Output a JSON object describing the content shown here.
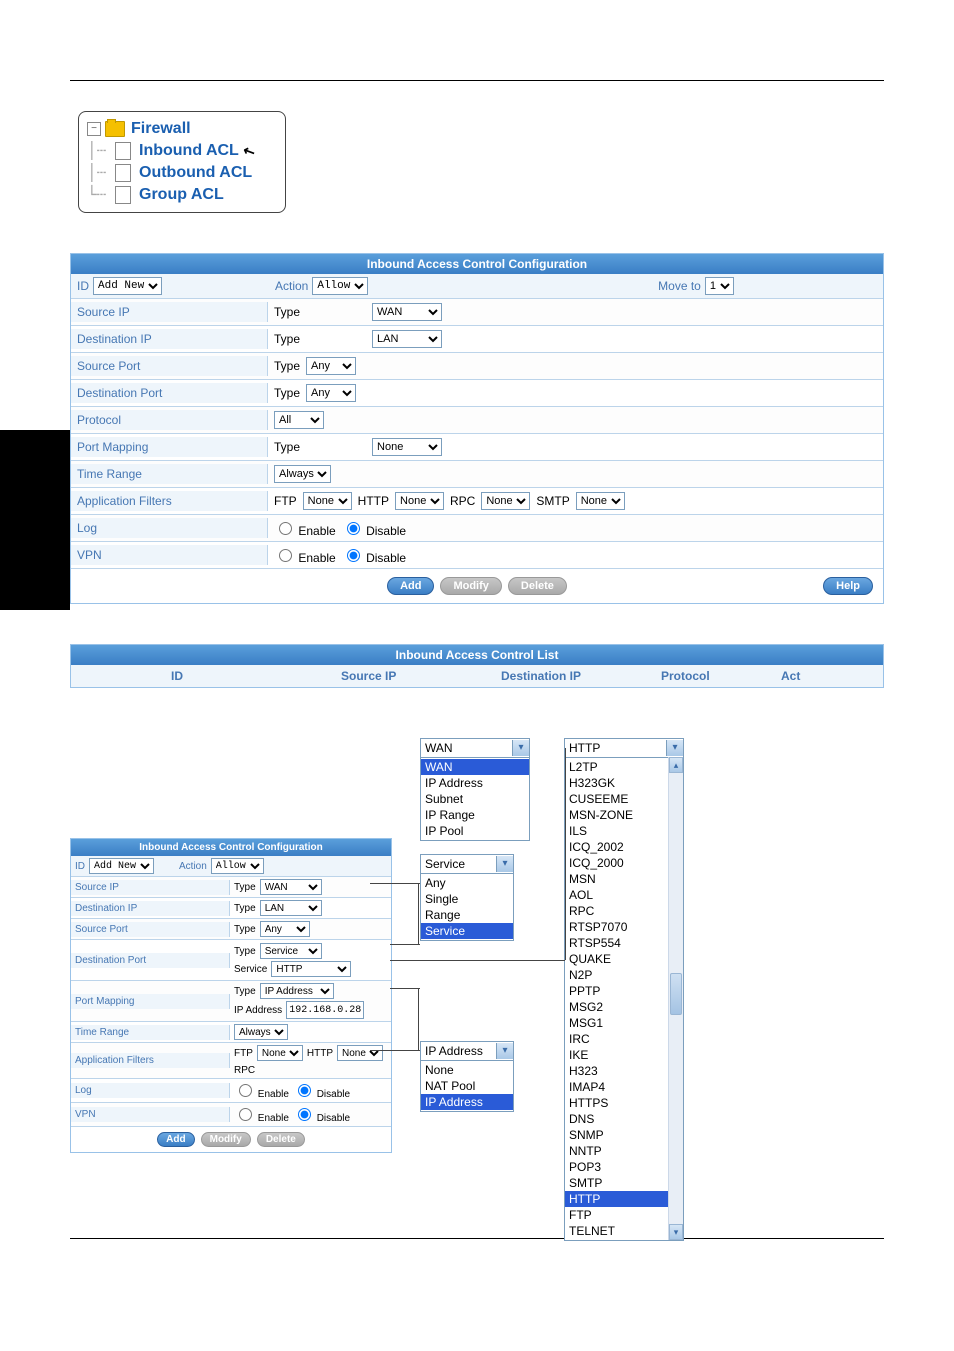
{
  "tree": {
    "root": "Firewall",
    "items": [
      "Inbound ACL",
      "Outbound ACL",
      "Group ACL"
    ]
  },
  "panel": {
    "title": "Inbound Access Control Configuration",
    "id_label": "ID",
    "id_value": "Add New",
    "action_label": "Action",
    "action_value": "Allow",
    "moveto_label": "Move to",
    "moveto_value": "1",
    "rows": {
      "source_ip": "Source IP",
      "destination_ip": "Destination IP",
      "source_port": "Source Port",
      "destination_port": "Destination Port",
      "protocol": "Protocol",
      "port_mapping": "Port Mapping",
      "time_range": "Time Range",
      "app_filters": "Application Filters",
      "log": "Log",
      "vpn": "VPN"
    },
    "type_label": "Type",
    "wan": "WAN",
    "lan": "LAN",
    "any": "Any",
    "all": "All",
    "none": "None",
    "always": "Always",
    "ftp": "FTP",
    "http": "HTTP",
    "rpc": "RPC",
    "smtp": "SMTP",
    "enable": "Enable",
    "disable": "Disable",
    "service_label": "Service",
    "ipaddress_label": "IP Address",
    "ipaddress_type": "IP Address",
    "service_type": "Service",
    "http_value": "HTTP",
    "ip_value": "192.168.0.28",
    "buttons": {
      "add": "Add",
      "modify": "Modify",
      "delete": "Delete",
      "help": "Help"
    }
  },
  "list": {
    "title": "Inbound Access Control List",
    "cols": [
      "ID",
      "Source IP",
      "Destination IP",
      "Protocol",
      "Act"
    ]
  },
  "popup_wan": {
    "selected": "WAN",
    "items": [
      "WAN",
      "IP Address",
      "Subnet",
      "IP Range",
      "IP Pool"
    ]
  },
  "popup_service": {
    "selected": "Service",
    "items": [
      "Any",
      "Single",
      "Range",
      "Service"
    ]
  },
  "popup_ipaddr": {
    "selected": "IP Address",
    "items": [
      "None",
      "NAT Pool",
      "IP Address"
    ]
  },
  "popup_http": {
    "selected": "HTTP",
    "items": [
      "L2TP",
      "H323GK",
      "CUSEEME",
      "MSN-ZONE",
      "ILS",
      "ICQ_2002",
      "ICQ_2000",
      "MSN",
      "AOL",
      "RPC",
      "RTSP7070",
      "RTSP554",
      "QUAKE",
      "N2P",
      "PPTP",
      "MSG2",
      "MSG1",
      "IRC",
      "IKE",
      "H323",
      "IMAP4",
      "HTTPS",
      "DNS",
      "SNMP",
      "NNTP",
      "POP3",
      "SMTP",
      "HTTP",
      "FTP",
      "TELNET"
    ]
  }
}
